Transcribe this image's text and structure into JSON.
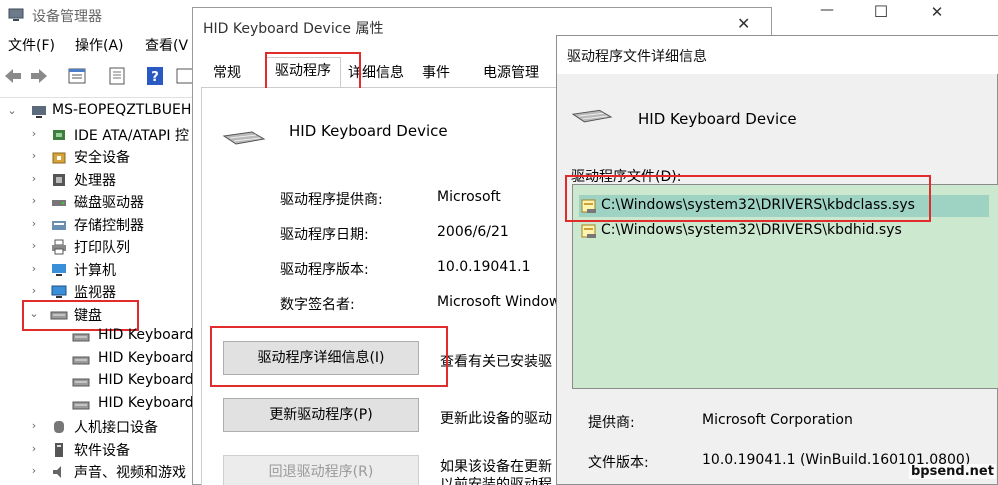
{
  "device_manager": {
    "title": "设备管理器",
    "menu": [
      "文件(F)",
      "操作(A)",
      "查看(V"
    ],
    "tree": {
      "root": "MS-EOPEQZTLBUEH",
      "categories": [
        "IDE ATA/ATAPI 控",
        "安全设备",
        "处理器",
        "磁盘驱动器",
        "存储控制器",
        "打印队列",
        "计算机",
        "监视器",
        "键盘",
        "人机接口设备",
        "软件设备",
        "声音、视频和游戏"
      ],
      "keyboard_children": [
        "HID Keyboard",
        "HID Keyboard",
        "HID Keyboard",
        "HID Keyboard"
      ]
    },
    "window_controls": {
      "minimize": "—",
      "maximize": "☐",
      "close": "✕"
    }
  },
  "properties": {
    "title": "HID Keyboard Device 属性",
    "close_glyph": "✕",
    "tabs": [
      "常规",
      "驱动程序",
      "详细信息",
      "事件",
      "电源管理"
    ],
    "active_tab": "驱动程序",
    "device_name": "HID Keyboard Device",
    "fields": {
      "provider_label": "驱动程序提供商:",
      "provider_value": "Microsoft",
      "date_label": "驱动程序日期:",
      "date_value": "2006/6/21",
      "version_label": "驱动程序版本:",
      "version_value": "10.0.19041.1",
      "signer_label": "数字签名者:",
      "signer_value": "Microsoft Window"
    },
    "buttons": {
      "details": "驱动程序详细信息(I)",
      "details_desc": "查看有关已安装驱",
      "update": "更新驱动程序(P)",
      "update_desc": "更新此设备的驱动",
      "rollback": "回退驱动程序(R)",
      "rollback_desc_1": "如果该设备在更新",
      "rollback_desc_2": "以前安装的驱动程"
    }
  },
  "driver_details": {
    "title": "驱动程序文件详细信息",
    "device_name": "HID Keyboard Device",
    "files_label": "驱动程序文件(D):",
    "files": [
      "C:\\Windows\\system32\\DRIVERS\\kbdclass.sys",
      "C:\\Windows\\system32\\DRIVERS\\kbdhid.sys"
    ],
    "provider_label": "提供商:",
    "provider_value": "Microsoft Corporation",
    "version_label": "文件版本:",
    "version_value": "10.0.19041.1 (WinBuild.160101.0800)"
  },
  "watermark": "bpsend.net",
  "colors": {
    "highlight": "#e12c2c",
    "list_bg": "#cce8cf",
    "selected_row": "#9ed3c4"
  }
}
